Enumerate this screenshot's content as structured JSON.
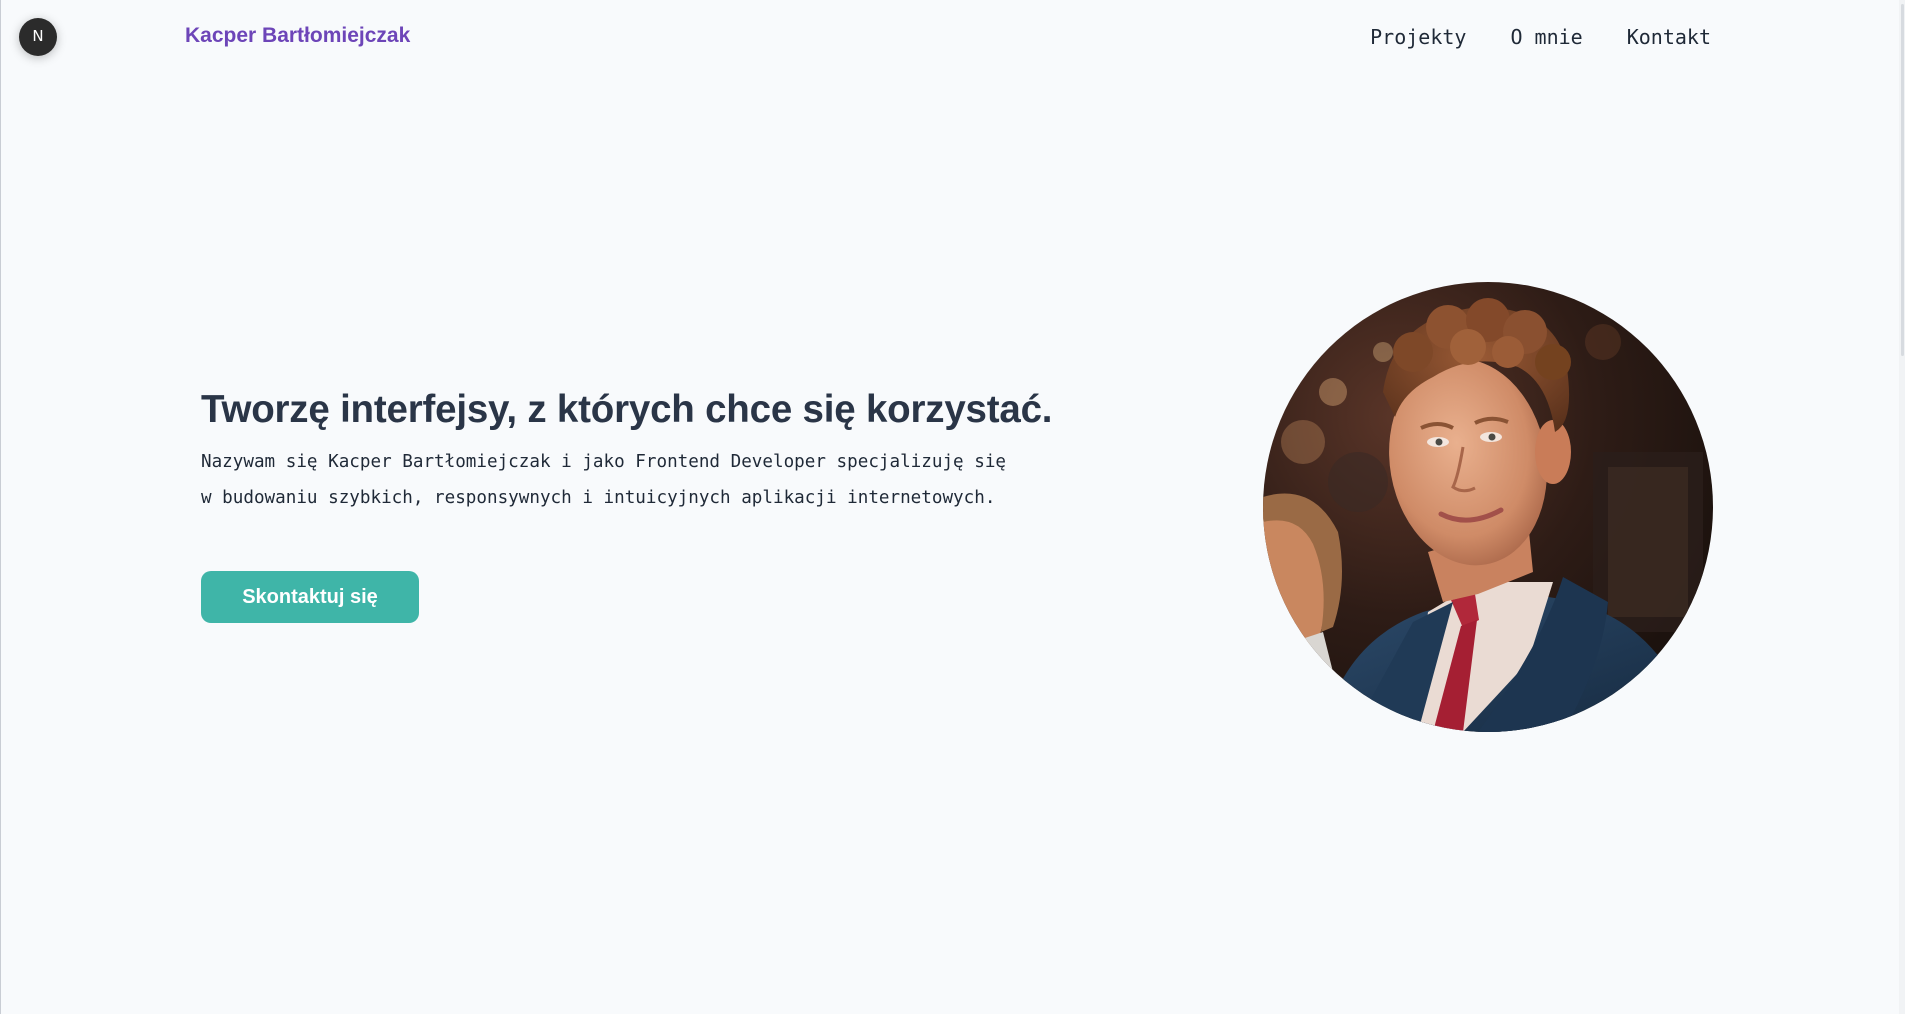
{
  "header": {
    "brand": "Kacper Bartłomiejczak",
    "nav": [
      "Projekty",
      "O mnie",
      "Kontakt"
    ]
  },
  "framework_badge": {
    "letter": "N",
    "icon": "nextjs-logo-icon"
  },
  "hero": {
    "title": "Tworzę interfejsy, z których chce się korzystać.",
    "description": "Nazywam się Kacper Bartłomiejczak i jako Frontend Developer specjalizuję się w budowaniu szybkich, responsywnych i intuicyjnych aplikacji internetowych.",
    "cta_label": "Skontaktuj się"
  },
  "portrait": {
    "subject": "profile-photo"
  },
  "colors": {
    "background": "#f8fafc",
    "brand": "#6d45b8",
    "heading": "#2a3547",
    "accent": "#3fb5a8"
  }
}
